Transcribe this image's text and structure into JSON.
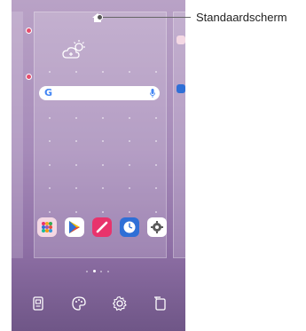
{
  "callout": {
    "label": "Standaardscherm"
  },
  "search_widget": {
    "logo": "G",
    "icons": [
      "google-logo",
      "mic-icon"
    ]
  },
  "dock_apps": [
    {
      "name": "apps-folder",
      "color": "#f2a0c0"
    },
    {
      "name": "play-store",
      "color": "#34a853"
    },
    {
      "name": "pen-app",
      "color": "#e8336c"
    },
    {
      "name": "clock-app",
      "color": "#2f6fd6"
    },
    {
      "name": "settings-app",
      "color": "#5b5b5b"
    }
  ],
  "bottom_actions": [
    {
      "name": "widgets-icon"
    },
    {
      "name": "wallpaper-palette-icon"
    },
    {
      "name": "home-settings-gear-icon"
    },
    {
      "name": "screen-rotate-icon"
    }
  ],
  "page_indicator": {
    "count": 4,
    "active": 1
  },
  "colors": {
    "background_top": "#b9a2c6",
    "background_bottom": "#6f5687",
    "badge": "#e64d6c"
  }
}
